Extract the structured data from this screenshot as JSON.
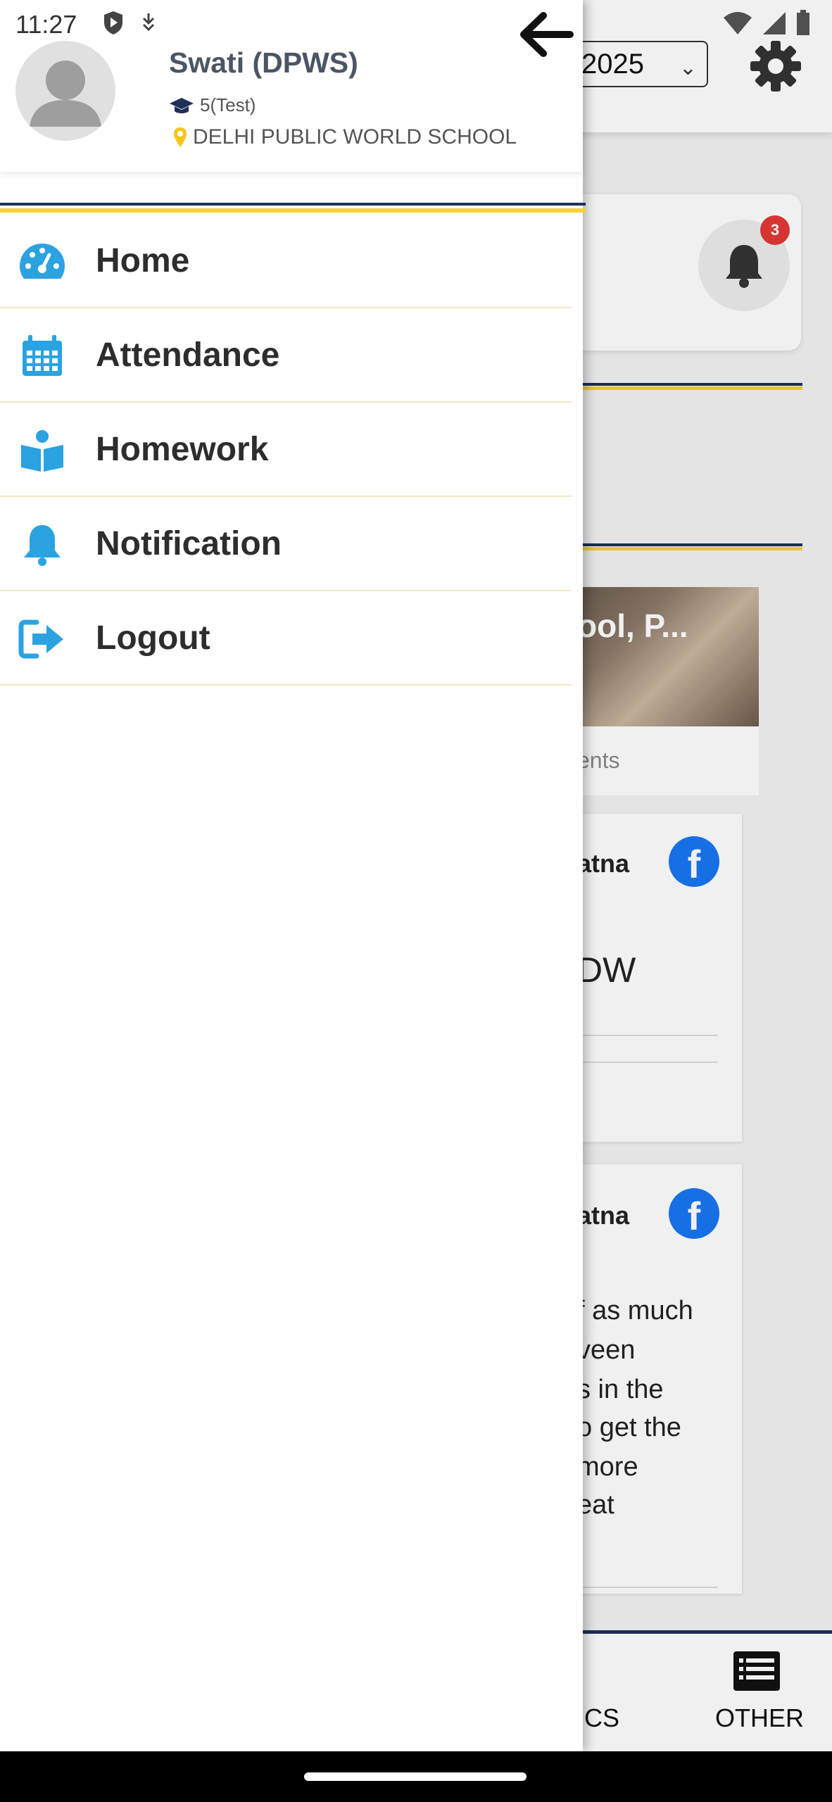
{
  "status_bar": {
    "time": "11:27"
  },
  "background": {
    "year_select": {
      "value": "2025"
    },
    "notification_badge": "3",
    "news": {
      "title": "ool, P...",
      "subtitle": "ents"
    },
    "posts": [
      {
        "author": "atna",
        "text_lines": [
          "DW"
        ]
      },
      {
        "author": "atna",
        "text_lines": [
          "f as much",
          "veen",
          "s in the",
          "o get the",
          "more",
          "eat"
        ]
      }
    ],
    "bottom_nav": {
      "tab_partial": "ICS",
      "tab_other": "OTHER"
    }
  },
  "drawer": {
    "user": {
      "name": "Swati (DPWS)",
      "class": "5(Test)",
      "school": "DELHI PUBLIC WORLD SCHOOL"
    },
    "menu": [
      {
        "label": "Home",
        "icon": "dashboard-icon"
      },
      {
        "label": "Attendance",
        "icon": "calendar-icon"
      },
      {
        "label": "Homework",
        "icon": "book-reader-icon"
      },
      {
        "label": "Notification",
        "icon": "bell-icon"
      },
      {
        "label": "Logout",
        "icon": "logout-icon"
      }
    ]
  },
  "colors": {
    "navy": "#1e2f5a",
    "yellow": "#f6d23b",
    "icon_blue": "#2aa3e0",
    "badge_red": "#e53935",
    "facebook": "#1877f2"
  }
}
